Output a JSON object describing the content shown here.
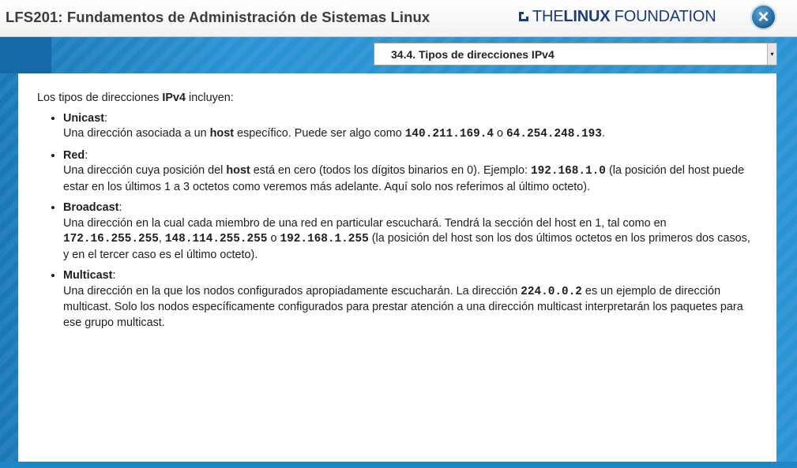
{
  "header": {
    "course_title": "LFS201: Fundamentos de Administración de Sistemas Linux",
    "logo": {
      "part1": "THE",
      "part2": "LINUX",
      "part3": " FOUNDATION"
    },
    "close_icon": "×"
  },
  "nav": {
    "section_selected": "34.4. Tipos de direcciones IPv4",
    "select_arrow": "▾"
  },
  "content": {
    "intro": {
      "before": "Los tipos de direcciones ",
      "bold": "IPv4",
      "after": " incluyen:"
    },
    "items": [
      {
        "term": "Unicast",
        "colon": ":",
        "p1": "Una dirección asociada a un ",
        "b1": "host",
        "p2": " específico. Puede ser algo como ",
        "c1": "140.211.169.4",
        "p3": " o ",
        "c2": "64.254.248.193",
        "p4": "."
      },
      {
        "term": "Red",
        "colon": ":",
        "p1": "Una dirección cuya posición del ",
        "b1": "host",
        "p2": " está en cero (todos los dígitos binarios en 0). Ejemplo: ",
        "c1": "192.168.1.0",
        "p3": " (la posición del host puede estar en los últimos 1 a 3 octetos como veremos más adelante. Aquí solo nos referimos al último octeto)."
      },
      {
        "term": "Broadcast",
        "colon": ":",
        "p1": "Una dirección en la cual cada miembro de una red en particular escuchará. Tendrá la sección del host en 1, tal como en ",
        "c1": "172.16.255.255",
        "p2": ", ",
        "c2": "148.114.255.255",
        "p3": " o ",
        "c3": "192.168.1.255",
        "p4": " (la posición del host son los dos últimos octetos en los primeros dos casos, y en el tercer caso es el último octeto)."
      },
      {
        "term": "Multicast",
        "colon": ":",
        "p1": "Una dirección en la que los nodos configurados apropiadamente escucharán. La dirección ",
        "c1": "224.0.0.2",
        "p2": " es un ejemplo de dirección multicast. Solo los nodos específicamente configurados para prestar atención a una dirección multicast interpretarán los paquetes para ese grupo multicast."
      }
    ]
  }
}
